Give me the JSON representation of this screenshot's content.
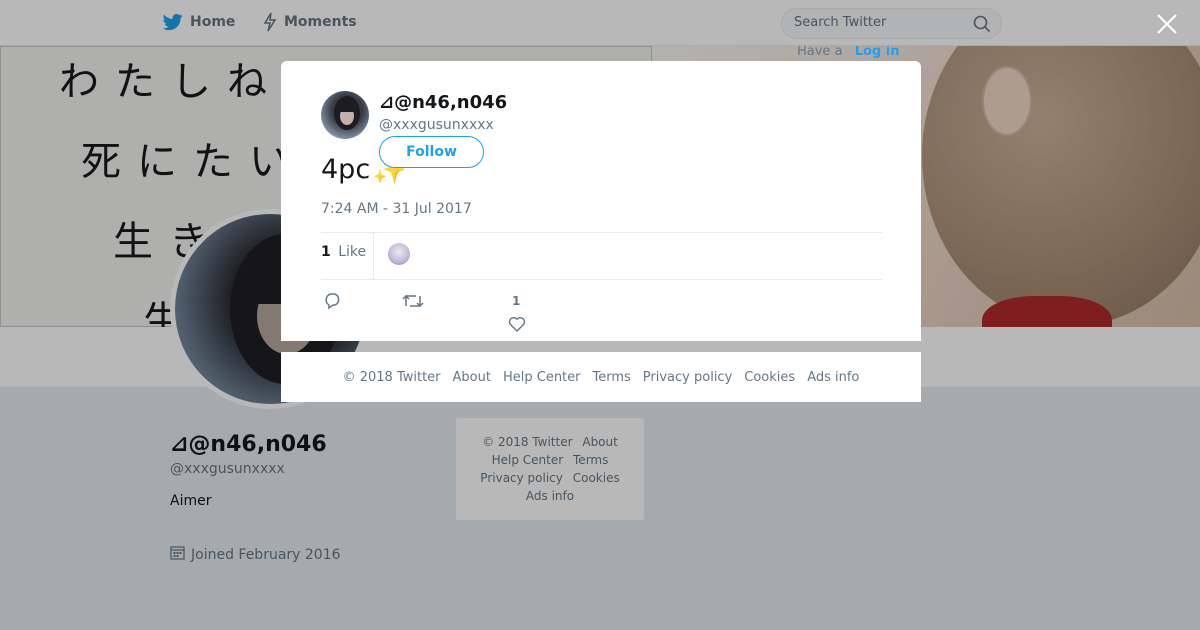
{
  "topbar": {
    "home_label": "Home",
    "moments_label": "Moments",
    "search_placeholder": "Search Twitter",
    "have_account": "Have a",
    "login_label": "Log in"
  },
  "banner": {
    "calligraphy": [
      "わたしねへ",
      "死にたい",
      "生き",
      "生"
    ]
  },
  "profile": {
    "name": "⊿@n46,n046",
    "handle": "@xxxgusunxxxx",
    "bio": "Aimer",
    "joined": "Joined February 2016"
  },
  "side_footer": {
    "links": [
      "© 2018 Twitter",
      "About",
      "Help Center",
      "Terms",
      "Privacy policy",
      "Cookies",
      "Ads info"
    ]
  },
  "tweet": {
    "author_name": "⊿@n46,n046",
    "author_handle": "@xxxgusunxxxx",
    "follow_label": "Follow",
    "text": "4pc",
    "sparkle": "✨",
    "timestamp": "7:24 AM - 31 Jul 2017",
    "like_count": "1",
    "like_label": "Like",
    "action_like_count": "1"
  },
  "modal_footer": {
    "links": [
      "© 2018 Twitter",
      "About",
      "Help Center",
      "Terms",
      "Privacy policy",
      "Cookies",
      "Ads info"
    ]
  },
  "colors": {
    "accent": "#1da1f2",
    "muted": "#657786",
    "text": "#14171a"
  },
  "icons": [
    "home-icon",
    "moments-icon",
    "search-icon",
    "close-icon",
    "calendar-icon",
    "reply-icon",
    "retweet-icon",
    "heart-icon"
  ]
}
